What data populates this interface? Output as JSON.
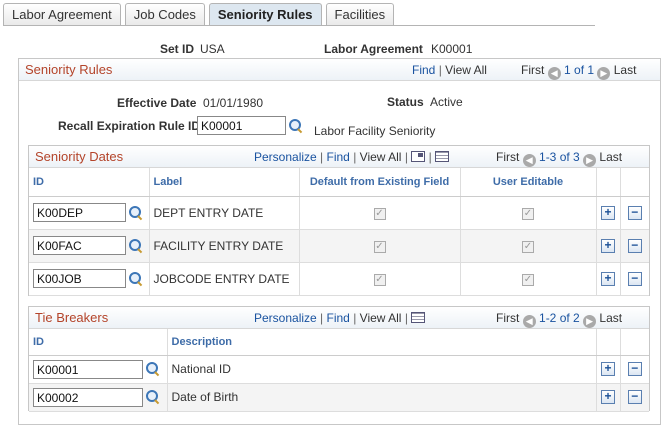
{
  "tabs": [
    {
      "label": "Labor Agreement"
    },
    {
      "label": "Job Codes"
    },
    {
      "label": "Seniority Rules"
    },
    {
      "label": "Facilities"
    }
  ],
  "header": {
    "setid_label": "Set ID",
    "setid_value": "USA",
    "labor_label": "Labor Agreement",
    "labor_value": "K00001"
  },
  "seniority_rules": {
    "title": "Seniority Rules",
    "find": "Find",
    "view_all": "View All",
    "first": "First",
    "range": "1 of 1",
    "last": "Last",
    "eff_date_label": "Effective Date",
    "eff_date_value": "01/01/1980",
    "status_label": "Status",
    "status_value": "Active",
    "recall_label": "Recall Expiration Rule ID",
    "recall_value": "K00001",
    "recall_desc": "Labor Facility Seniority"
  },
  "seniority_dates": {
    "title": "Seniority Dates",
    "personalize": "Personalize",
    "find": "Find",
    "view_all": "View All",
    "first": "First",
    "range": "1-3 of 3",
    "last": "Last",
    "columns": {
      "id": "ID",
      "label": "Label",
      "default": "Default from Existing Field",
      "editable": "User Editable"
    },
    "rows": [
      {
        "id": "K00DEP",
        "label": "DEPT ENTRY DATE"
      },
      {
        "id": "K00FAC",
        "label": "FACILITY ENTRY DATE"
      },
      {
        "id": "K00JOB",
        "label": "JOBCODE ENTRY DATE"
      }
    ]
  },
  "tie_breakers": {
    "title": "Tie Breakers",
    "personalize": "Personalize",
    "find": "Find",
    "view_all": "View All",
    "first": "First",
    "range": "1-2 of 2",
    "last": "Last",
    "columns": {
      "id": "ID",
      "description": "Description"
    },
    "rows": [
      {
        "id": "K00001",
        "description": "National ID"
      },
      {
        "id": "K00002",
        "description": "Date of Birth"
      }
    ]
  },
  "glyphs": {
    "check": "✓",
    "plus": "+",
    "minus": "−",
    "prev": "◀",
    "next": "▶",
    "pipe": "|"
  }
}
